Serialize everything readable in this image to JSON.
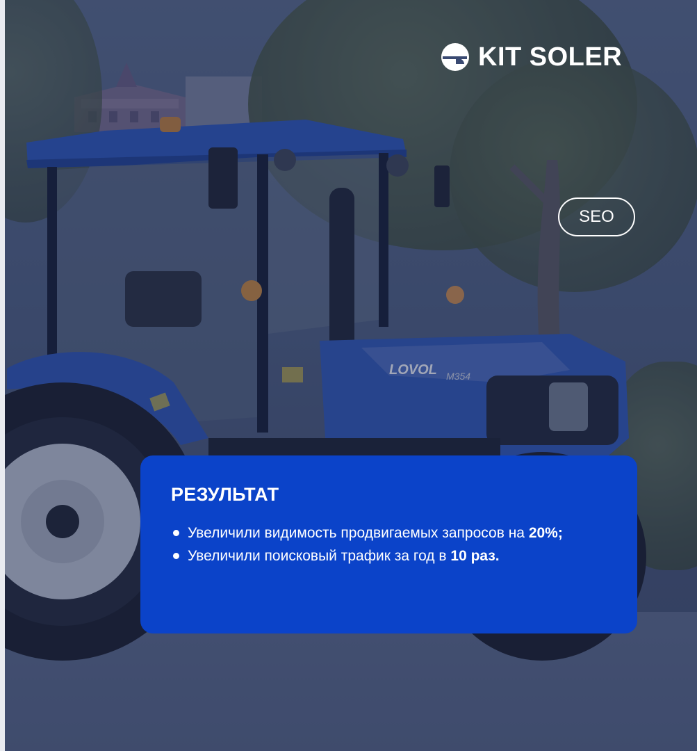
{
  "brand": {
    "name": "KIT SOLER",
    "logo_icon": "kit-soler-logo-icon"
  },
  "tag": {
    "label": "SEO"
  },
  "result": {
    "title": "РЕЗУЛЬТАТ",
    "items": [
      {
        "prefix": "Увеличили видимость продвигаемых запросов на ",
        "highlight": "20%;"
      },
      {
        "prefix": "Увеличили поисковый трафик за год в ",
        "highlight": "10 раз."
      }
    ]
  },
  "photo": {
    "tractor_badge": "LOVOL",
    "tractor_model": "M354"
  },
  "colors": {
    "card_background": "#0b43c9",
    "overlay_tint": "#1e2a54",
    "text": "#ffffff"
  }
}
